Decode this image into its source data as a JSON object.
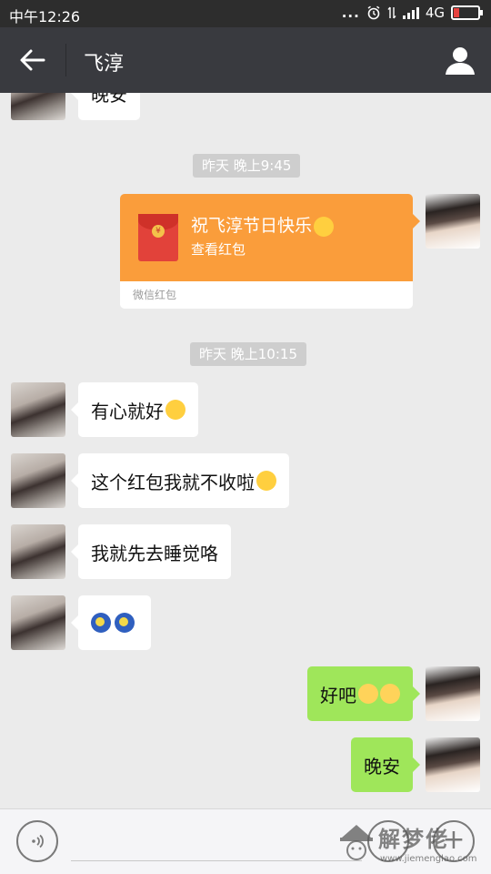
{
  "status_bar": {
    "time": "中午12:26",
    "network": "4G",
    "dots": "..."
  },
  "header": {
    "title": "飞淳"
  },
  "chat": {
    "partial_top_message": "晚安",
    "timestamps": [
      "昨天 晚上9:45",
      "昨天 晚上10:15"
    ],
    "red_packet": {
      "greeting": "祝飞淳节日快乐",
      "action": "查看红包",
      "source": "微信红包"
    },
    "messages": [
      {
        "side": "left",
        "text": "有心就好"
      },
      {
        "side": "left",
        "text": "这个红包我就不收啦"
      },
      {
        "side": "left",
        "text": "我就先去睡觉咯"
      },
      {
        "side": "left",
        "text": ""
      },
      {
        "side": "right",
        "text": "好吧"
      },
      {
        "side": "right",
        "text": "晚安"
      }
    ]
  },
  "input_bar": {
    "voice_icon": "voice-icon",
    "emoji_icon": "emoji-icon",
    "plus_icon": "plus-icon"
  },
  "watermark": {
    "brand": "解梦佬",
    "url": "www.jiemenglao.com"
  },
  "colors": {
    "header": "#393a3f",
    "red_packet": "#fa9d3b",
    "bubble_sent": "#9fe65a",
    "bubble_received": "#ffffff",
    "chat_bg": "#ebebeb"
  }
}
